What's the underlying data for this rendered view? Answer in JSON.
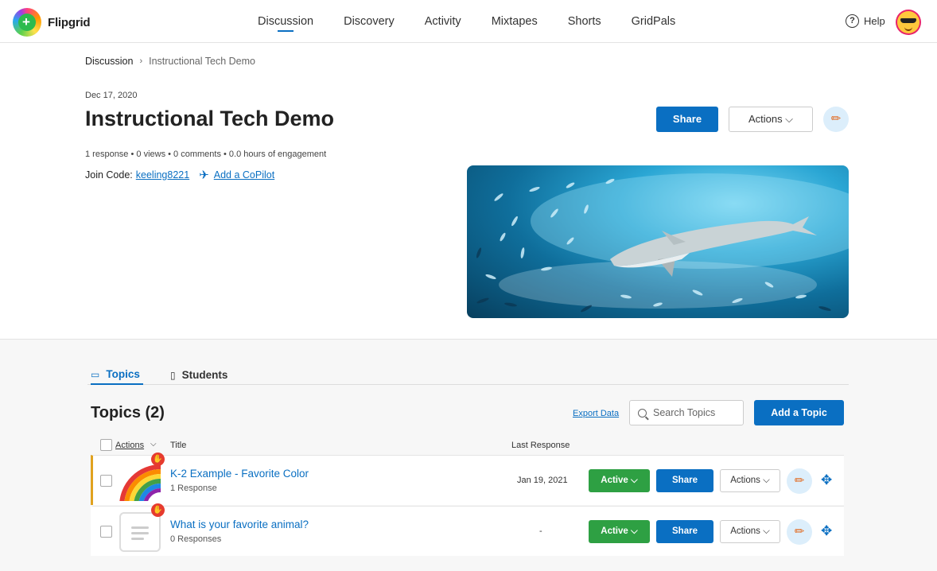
{
  "app": {
    "name": "Flipgrid"
  },
  "nav": {
    "items": [
      "Discussion",
      "Discovery",
      "Activity",
      "Mixtapes",
      "Shorts",
      "GridPals"
    ],
    "active": "Discussion"
  },
  "header": {
    "help_label": "Help"
  },
  "breadcrumb": {
    "parent": "Discussion",
    "separator": "›",
    "current": "Instructional Tech Demo"
  },
  "group": {
    "date": "Dec 17, 2020",
    "title": "Instructional Tech Demo",
    "stats": "1 response • 0 views • 0 comments • 0.0 hours of engagement",
    "join_label": "Join Code:",
    "join_code": "keeling8221",
    "copilot_label": "Add a CoPilot",
    "share_label": "Share",
    "actions_label": "Actions ⌵"
  },
  "tabs": {
    "topics": "Topics",
    "students": "Students",
    "active": "Topics"
  },
  "topics": {
    "heading": "Topics (2)",
    "export_label": "Export Data",
    "search_placeholder": "Search Topics",
    "add_label": "Add a Topic",
    "columns": {
      "actions": "Actions",
      "title": "Title",
      "last_response": "Last Response"
    },
    "rows": [
      {
        "title": "K-2 Example - Favorite Color",
        "responses": "1 Response",
        "last_response": "Jan 19, 2021",
        "status": "Active ⌵",
        "share": "Share",
        "actions": "Actions ⌵"
      },
      {
        "title": "What is your favorite animal?",
        "responses": "0 Responses",
        "last_response": "-",
        "status": "Active ⌵",
        "share": "Share",
        "actions": "Actions ⌵"
      }
    ]
  },
  "colors": {
    "primary": "#0a6fc2",
    "active_green": "#2ea043",
    "hand_red": "#e63b2e"
  }
}
